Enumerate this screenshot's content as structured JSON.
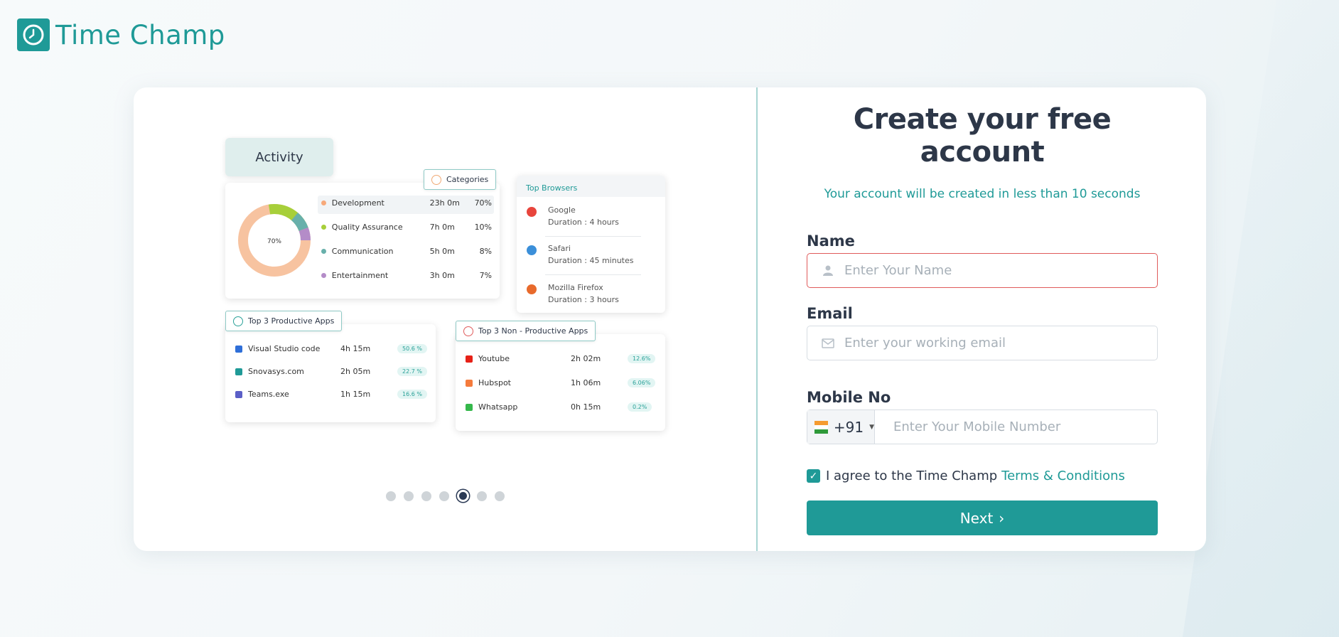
{
  "brand": {
    "name": "Time Champ",
    "color": "#1f9a97"
  },
  "carousel": {
    "activity_tab": "Activity",
    "categories": {
      "chip": "Categories",
      "donut_center": "70%",
      "rows": [
        {
          "label": "Development",
          "time": "23h 0m",
          "pct": "70%",
          "color": "#f7a97a",
          "share": 70
        },
        {
          "label": "Quality Assurance",
          "time": "7h 0m",
          "pct": "10%",
          "color": "#a7cf3a",
          "share": 10
        },
        {
          "label": "Communication",
          "time": "5h 0m",
          "pct": "8%",
          "color": "#68b0ab",
          "share": 8
        },
        {
          "label": "Entertainment",
          "time": "3h 0m",
          "pct": "7%",
          "color": "#b48cc8",
          "share": 7
        }
      ]
    },
    "browsers": {
      "title": "Top Browsers",
      "rows": [
        {
          "name": "Google",
          "duration": "Duration : 4 hours",
          "icon": "chrome-icon"
        },
        {
          "name": "Safari",
          "duration": "Duration : 45 minutes",
          "icon": "safari-icon"
        },
        {
          "name": "Mozilla Firefox",
          "duration": "Duration : 3 hours",
          "icon": "firefox-icon"
        }
      ]
    },
    "productive": {
      "chip": "Top 3 Productive Apps",
      "rows": [
        {
          "name": "Visual Studio code",
          "time": "4h 15m",
          "badge": "50.6 %"
        },
        {
          "name": "Snovasys.com",
          "time": "2h 05m",
          "badge": "22.7 %"
        },
        {
          "name": "Teams.exe",
          "time": "1h 15m",
          "badge": "16.6 %"
        }
      ]
    },
    "non_productive": {
      "chip": "Top 3 Non - Productive Apps",
      "rows": [
        {
          "name": "Youtube",
          "time": "2h 02m",
          "badge": "12.6%"
        },
        {
          "name": "Hubspot",
          "time": "1h 06m",
          "badge": "6.06%"
        },
        {
          "name": "Whatsapp",
          "time": "0h 15m",
          "badge": "0.2%"
        }
      ]
    },
    "pager": {
      "count": 7,
      "active_index": 4
    }
  },
  "form": {
    "title": "Create your free account",
    "subtitle": "Your account will be created in less than 10 seconds",
    "name": {
      "label": "Name",
      "placeholder": "Enter Your Name",
      "value": ""
    },
    "email": {
      "label": "Email",
      "placeholder": "Enter your working email",
      "value": ""
    },
    "mobile": {
      "label": "Mobile No",
      "country_code": "+91",
      "placeholder": "Enter Your Mobile Number",
      "value": ""
    },
    "agree": {
      "text": "I agree to the Time Champ",
      "link": "Terms & Conditions",
      "checked": true
    },
    "next_label": "Next"
  }
}
